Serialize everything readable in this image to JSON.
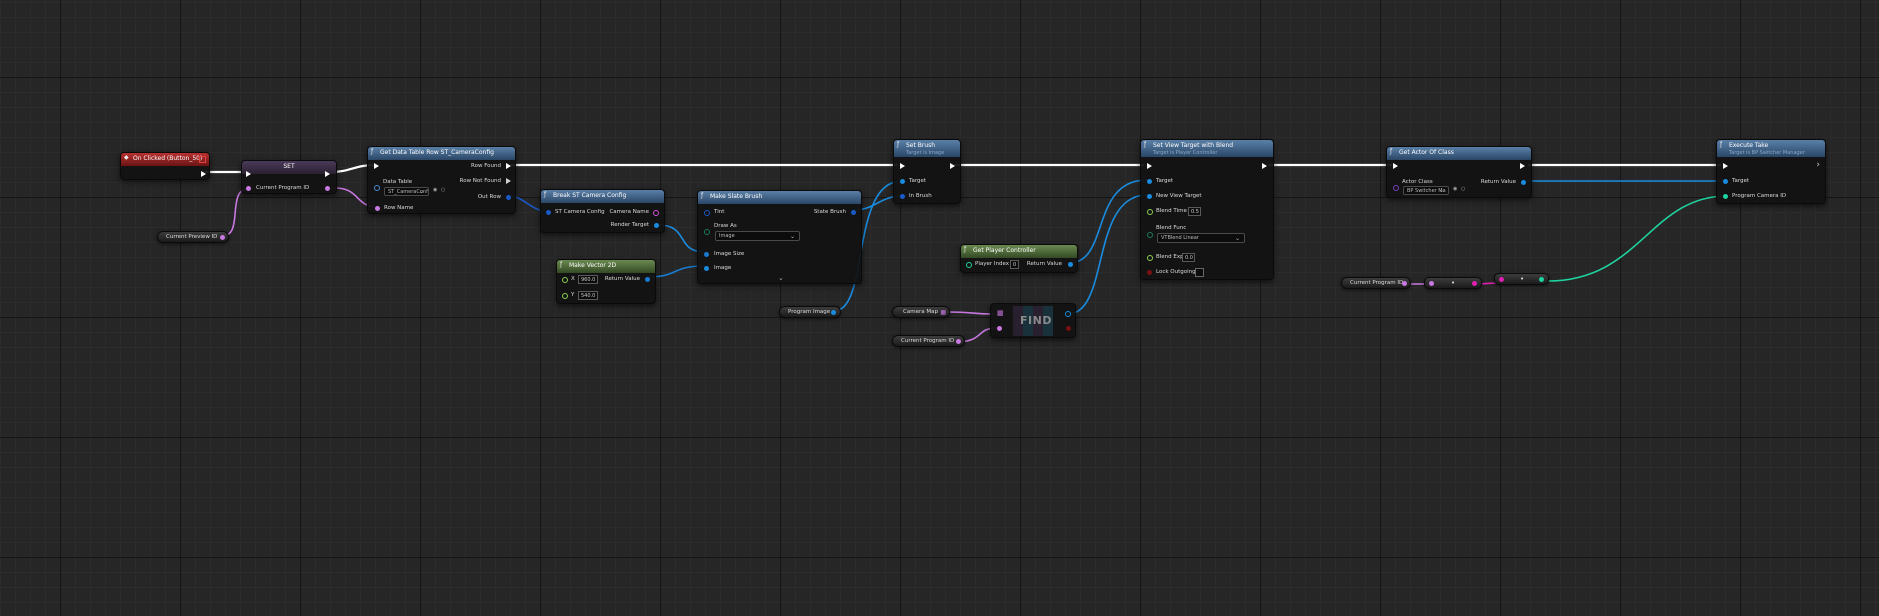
{
  "event_node": {
    "title": "On Clicked (Button_50)"
  },
  "set_node": {
    "title": "SET",
    "pin": "Current Program ID"
  },
  "current_preview": {
    "label": "Current Preview ID"
  },
  "get_row": {
    "title": "Get Data Table Row ST_CameraConfig",
    "row_found": "Row Found",
    "row_not_found": "Row Not Found",
    "data_table": "Data Table",
    "data_table_value": "ST_CameraConf",
    "out_row": "Out Row",
    "row_name": "Row Name"
  },
  "break_node": {
    "title": "Break ST Camera Config",
    "in_pin": "ST Camera Config",
    "camera_name": "Camera Name",
    "render_target": "Render Target"
  },
  "make_vec": {
    "title": "Make Vector 2D",
    "x_label": "X",
    "x_value": "960.0",
    "y_label": "Y",
    "y_value": "540.0",
    "ret": "Return Value"
  },
  "make_brush": {
    "title": "Make Slate Brush",
    "tint": "Tint",
    "state_brush": "State Brush",
    "draw_as": "Draw As",
    "draw_as_value": "Image",
    "image_size": "Image Size",
    "image": "Image"
  },
  "program_image": {
    "label": "Program Image"
  },
  "set_brush": {
    "title": "Set Brush",
    "subtitle": "Target is Image",
    "target": "Target",
    "in_brush": "In Brush"
  },
  "get_pc": {
    "title": "Get Player Controller",
    "player_index": "Player Index",
    "player_index_value": "0",
    "ret": "Return Value"
  },
  "camera_map": {
    "label": "Camera Map"
  },
  "current_program_2": {
    "label": "Current Program ID"
  },
  "find": {
    "label": "FIND"
  },
  "set_view": {
    "title": "Set View Target with Blend",
    "subtitle": "Target is Player Controller",
    "target": "Target",
    "new_view_target": "New View Target",
    "blend_time": "Blend Time",
    "blend_time_value": "0.5",
    "blend_func": "Blend Func",
    "blend_func_value": "VTBlend Linear",
    "blend_exp": "Blend Exp",
    "blend_exp_value": "0.0",
    "lock_outgoing": "Lock Outgoing"
  },
  "get_actor": {
    "title": "Get Actor Of Class",
    "actor_class": "Actor Class",
    "actor_class_value": "BP Switcher Ma",
    "ret": "Return Value"
  },
  "execute_take": {
    "title": "Execute Take",
    "subtitle": "Target is BP Switcher Manager",
    "target": "Target",
    "program_camera_id": "Program Camera ID"
  },
  "current_program_3": {
    "label": "Current Program ID"
  },
  "colors": {
    "exec": "#ffffff",
    "object": "#1a8ce0",
    "string": "#d050d0",
    "integer": "#1fd3a0",
    "struct": "#1a5ac8",
    "vector2d": "#1a7ad0"
  }
}
